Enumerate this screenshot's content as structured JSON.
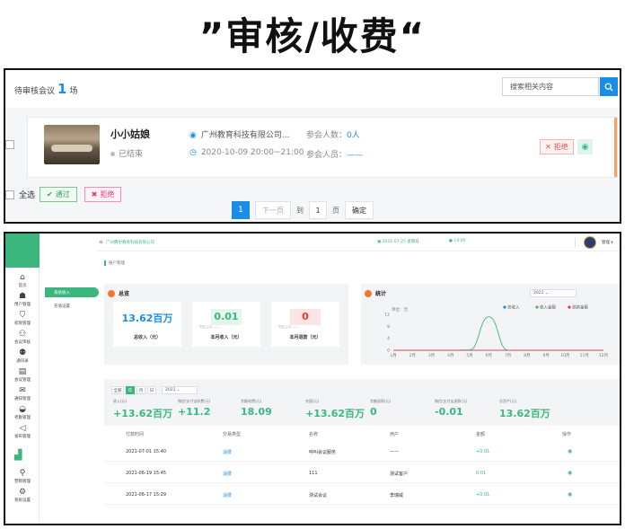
{
  "banner": {
    "title": "”审核/收费“"
  },
  "review": {
    "pending_label": "待审核会议",
    "pending_count": "1",
    "pending_unit": "场",
    "search_placeholder": "搜索相关内容",
    "meeting": {
      "name": "小小姑娘",
      "status": "已结束",
      "company": "广州教育科技有限公司...",
      "time": "2020-10-09 20:00~21:00",
      "count_label": "参会人数：",
      "count_value": "0人",
      "members_label": "参会人员：",
      "members_value": "——",
      "reject_label": "拒绝"
    },
    "select_all_label": "全选",
    "pass_label": "通过",
    "reject_label": "拒绝",
    "pager": {
      "current": "1",
      "next_label": "下一页",
      "goto_label": "到",
      "goto_value": "1",
      "page_unit": "页",
      "confirm_label": "确定"
    }
  },
  "dashboard": {
    "company": "广州腾尔教育科技有限公司",
    "date": "2021-07-25 星期日",
    "time": "14:05",
    "user": "管理",
    "breadcrumb": "账户管理",
    "sidebar": [
      {
        "label": "首页",
        "icon": "home-icon"
      },
      {
        "label": "用户管理",
        "icon": "user-icon"
      },
      {
        "label": "权限管理",
        "icon": "shield-icon"
      },
      {
        "label": "会议审核",
        "icon": "review-icon"
      },
      {
        "label": "通讯录",
        "icon": "contacts-icon"
      },
      {
        "label": "会议管理",
        "icon": "document-icon"
      },
      {
        "label": "通知管理",
        "icon": "mail-icon"
      },
      {
        "label": "考勤管理",
        "icon": "attendance-icon"
      },
      {
        "label": "发布管理",
        "icon": "send-icon"
      }
    ],
    "sidebar_lower": [
      {
        "label": "营销管理",
        "icon": "network-icon"
      },
      {
        "label": "系统设置",
        "icon": "gear-icon"
      }
    ],
    "subnav": {
      "active": "系统收入",
      "item": "充值设置"
    },
    "overview": {
      "title": "总览",
      "cards": [
        {
          "value": "13.62百万",
          "label": "总收入（元）",
          "color": "#1a8ee6"
        },
        {
          "value": "0.01",
          "label": "本月收入（元）",
          "sub": "同比上月 ——",
          "color": "#3bb77e"
        },
        {
          "value": "0",
          "label": "本月退款（元）",
          "sub": "同比上月 ——",
          "color": "#e53935"
        }
      ]
    },
    "stats": {
      "title": "统计",
      "year": "2021",
      "unit_label": "单位：元"
    },
    "filter": {
      "buttons": [
        "全部",
        "年",
        "月",
        "日"
      ],
      "active": "年",
      "year": "2021"
    },
    "metrics": [
      {
        "label": "收入(元)",
        "value": "+13.62百万"
      },
      {
        "label": "微信/支付宝收费(元)",
        "value": "+11.2"
      },
      {
        "label": "余额收费(元)",
        "value": "18.09"
      },
      {
        "label": "充值(元)",
        "value": "+13.62百万"
      },
      {
        "label": "余额退款(元)",
        "value": "0"
      },
      {
        "label": "微信/支付宝退款(元)",
        "value": "-0.01"
      },
      {
        "label": "总资产(元)",
        "value": "13.62百万"
      }
    ],
    "table": {
      "columns": [
        "付款时间",
        "交易类型",
        "名称",
        "用户",
        "金额",
        "操作"
      ],
      "rows": [
        {
          "time": "2021-07-01 15:40",
          "type": "消费",
          "name": "呼叫会议服务",
          "user": "——",
          "amount": "+0.01"
        },
        {
          "time": "2021-06-19 15:45",
          "type": "消费",
          "name": "111",
          "user": "测试客户",
          "amount": "0.01"
        },
        {
          "time": "2021-06-17 15:29",
          "type": "消费",
          "name": "测试会议",
          "user": "李瑞威",
          "amount": "+0.01"
        }
      ]
    }
  },
  "chart_data": {
    "type": "line",
    "title": "统计",
    "ylabel": "单位：元",
    "categories": [
      "1月",
      "2月",
      "3月",
      "4月",
      "5月",
      "6月",
      "7月",
      "8月",
      "9月",
      "10月",
      "11月",
      "12月"
    ],
    "ylim": [
      0,
      12
    ],
    "yticks": [
      0,
      4,
      8,
      12
    ],
    "series": [
      {
        "name": "总收入",
        "color": "#1a8ee6",
        "values": [
          0,
          0,
          0,
          0,
          0,
          0,
          0,
          0,
          0,
          0,
          0,
          0
        ]
      },
      {
        "name": "收入金额",
        "color": "#3bb77e",
        "values": [
          0,
          0,
          0,
          0,
          0.1,
          11.2,
          0.01,
          0,
          0,
          0,
          0,
          0
        ]
      },
      {
        "name": "退款金额",
        "color": "#e53935",
        "values": [
          0,
          0,
          0,
          0,
          0,
          0,
          0,
          0,
          0,
          0,
          0,
          0
        ]
      }
    ],
    "legend": "top-right"
  }
}
